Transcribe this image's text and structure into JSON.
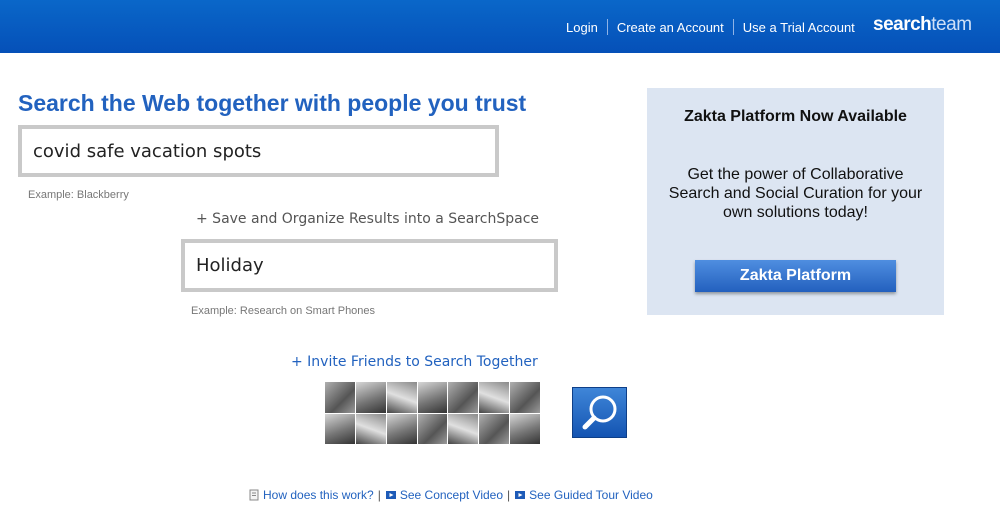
{
  "header": {
    "nav": [
      "Login",
      "Create an Account",
      "Use a Trial Account"
    ],
    "logo": {
      "bold": "search",
      "light": "team"
    }
  },
  "main": {
    "headline": "Search the Web together with people you trust",
    "query": {
      "value": "covid safe vacation spots",
      "example": "Example: Blackberry"
    },
    "save_link": "+ Save and Organize Results into a SearchSpace",
    "space": {
      "value": "Holiday",
      "example": "Example: Research on Smart Phones"
    },
    "invite_link": "+ Invite Friends to Search Together"
  },
  "panel": {
    "title": "Zakta Platform Now Available",
    "text": "Get the power of Collaborative Search and Social Curation for your own solutions today!",
    "button": "Zakta Platform"
  },
  "footer": {
    "links": [
      "How does this work?",
      "See Concept Video",
      "See Guided Tour Video"
    ],
    "separator": "|"
  },
  "colors": {
    "topbar": "#0550b8",
    "link": "#2262bf",
    "panel_bg": "#dce5f2"
  }
}
